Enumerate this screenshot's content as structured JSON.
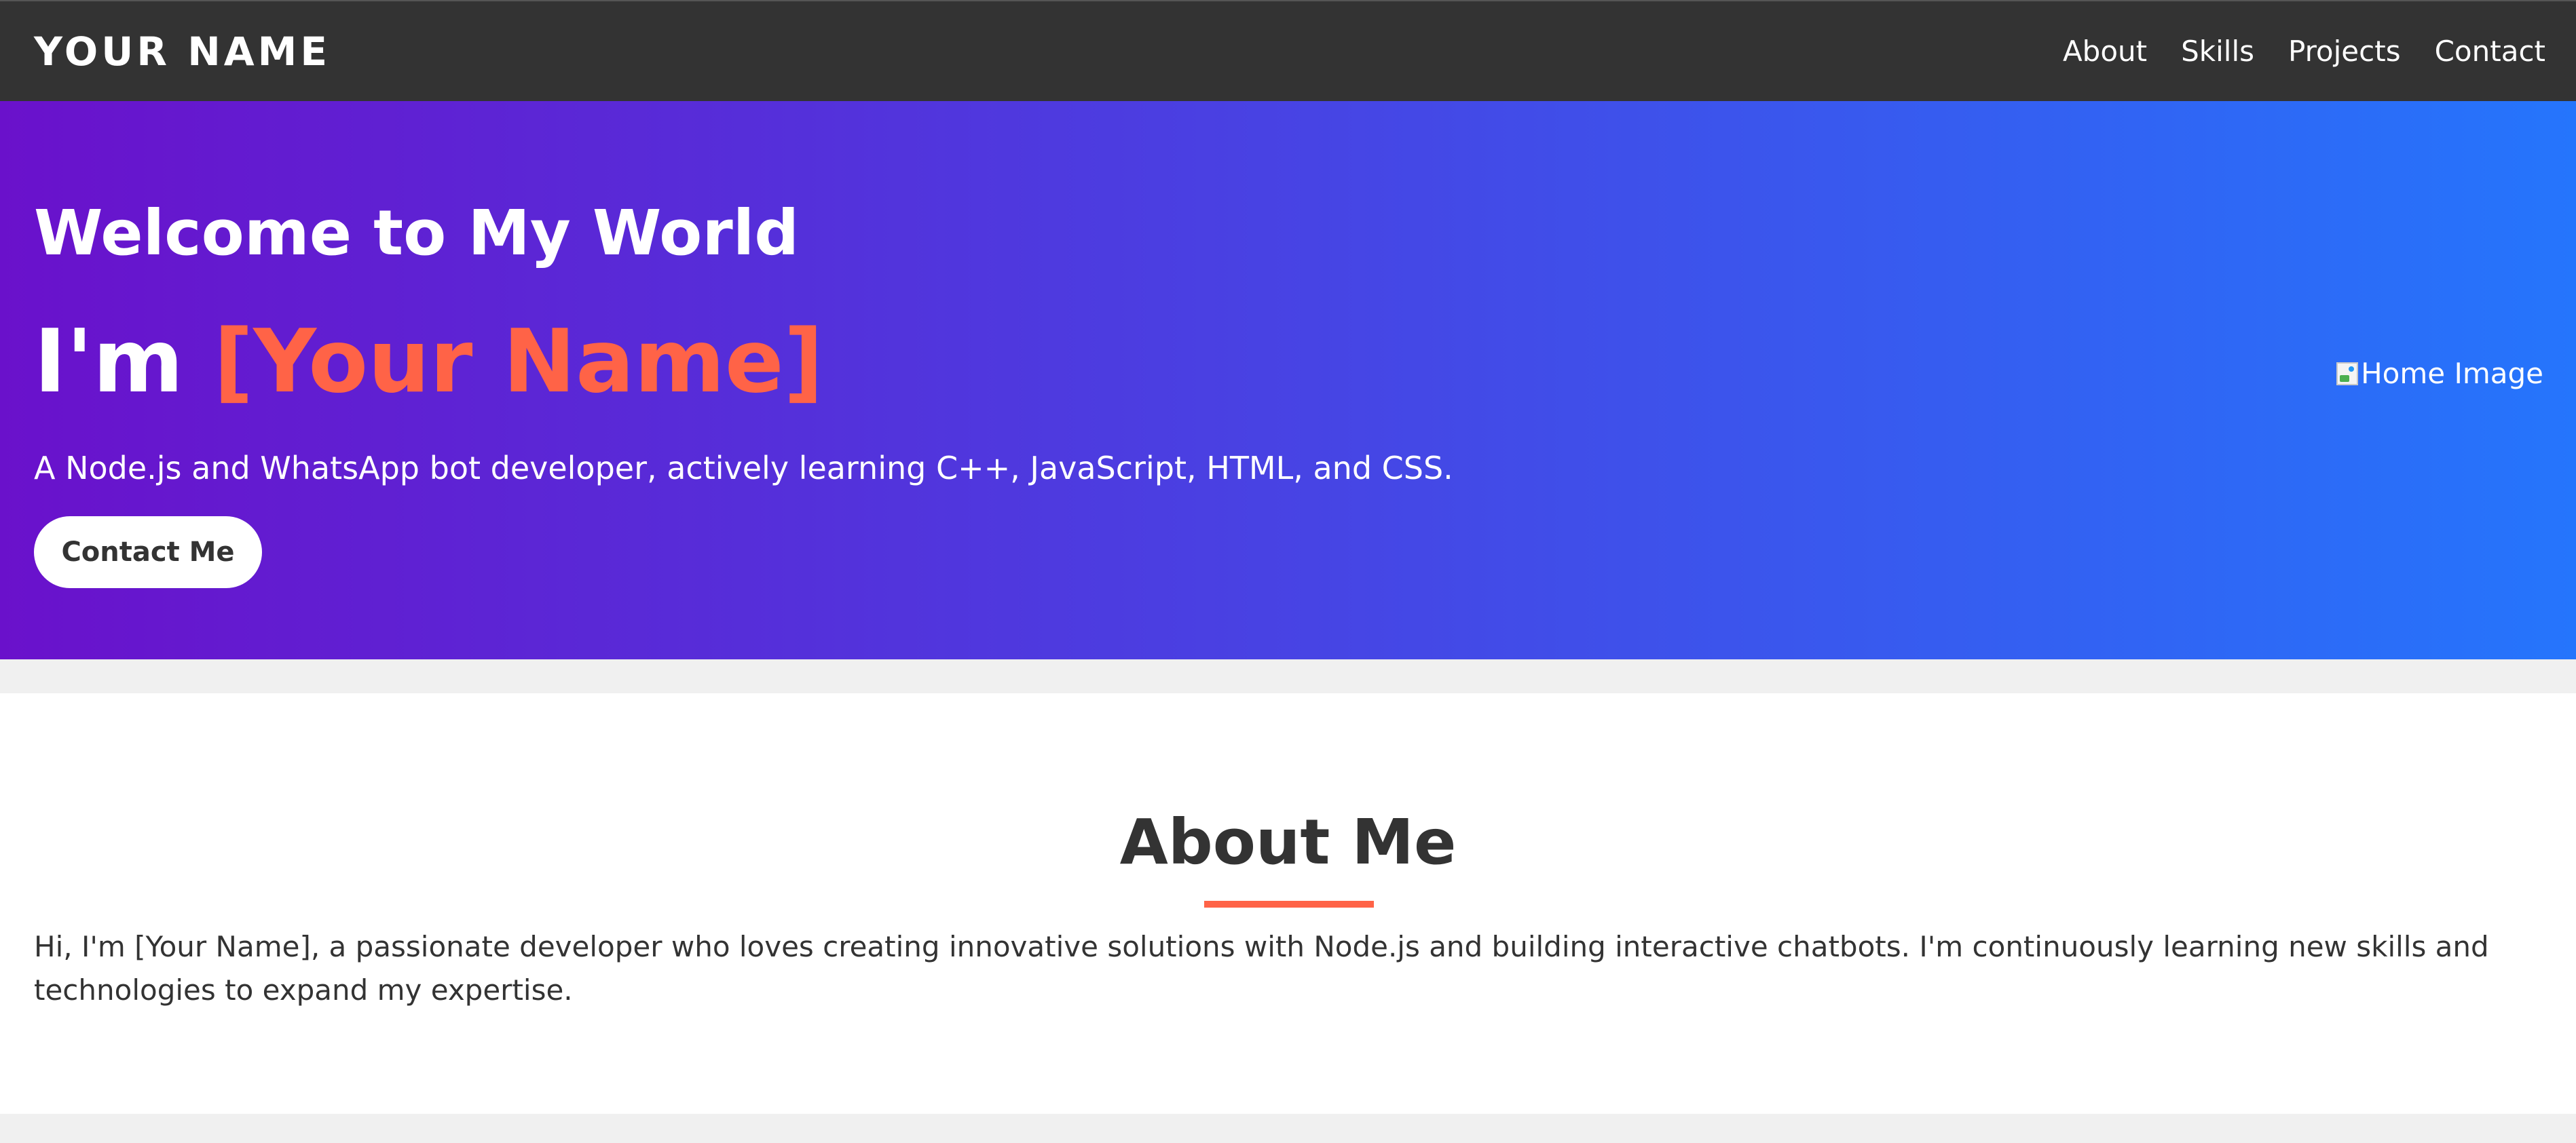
{
  "navbar": {
    "brand": "YOUR NAME",
    "links": [
      "About",
      "Skills",
      "Projects",
      "Contact"
    ]
  },
  "hero": {
    "greeting": "Welcome to My World",
    "intro_prefix": "I'm ",
    "name": "[Your Name]",
    "description": "A Node.js and WhatsApp bot developer, actively learning C++, JavaScript, HTML, and CSS.",
    "cta_label": "Contact Me",
    "image_alt": "Home Image"
  },
  "about": {
    "title": "About Me",
    "text": "Hi, I'm [Your Name], a passionate developer who loves creating innovative solutions with Node.js and building interactive chatbots. I'm continuously learning new skills and technologies to expand my expertise."
  },
  "colors": {
    "navbar_bg": "#333333",
    "accent": "#ff6347",
    "hero_gradient_start": "#6a11cb",
    "hero_gradient_end": "#2575fc",
    "page_bg": "#f0f0f0"
  }
}
